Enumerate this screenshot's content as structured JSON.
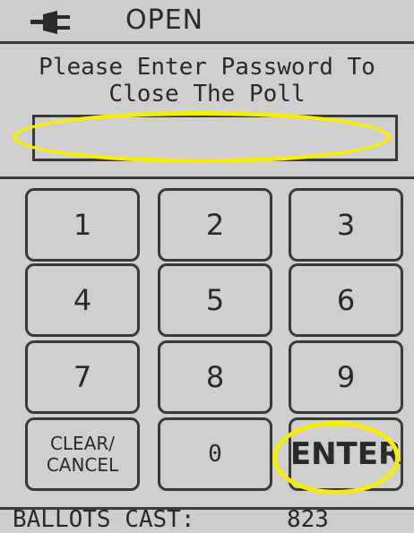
{
  "header": {
    "icon": "power-plug-icon",
    "status": "OPEN"
  },
  "prompt": "Please Enter Password To\nClose The Poll",
  "password_field": {
    "value": ""
  },
  "keypad": {
    "k1": "1",
    "k2": "2",
    "k3": "3",
    "k4": "4",
    "k5": "5",
    "k6": "6",
    "k7": "7",
    "k8": "8",
    "k9": "9",
    "clear": "CLEAR/\nCANCEL",
    "k0": "0",
    "enter": "ENTER"
  },
  "footer": {
    "ballots_label": "BALLOTS CAST:",
    "ballots_count": "823"
  },
  "colors": {
    "background": "#cfcfcf",
    "border": "#3a3a3a",
    "highlight": "#f5ee00"
  }
}
